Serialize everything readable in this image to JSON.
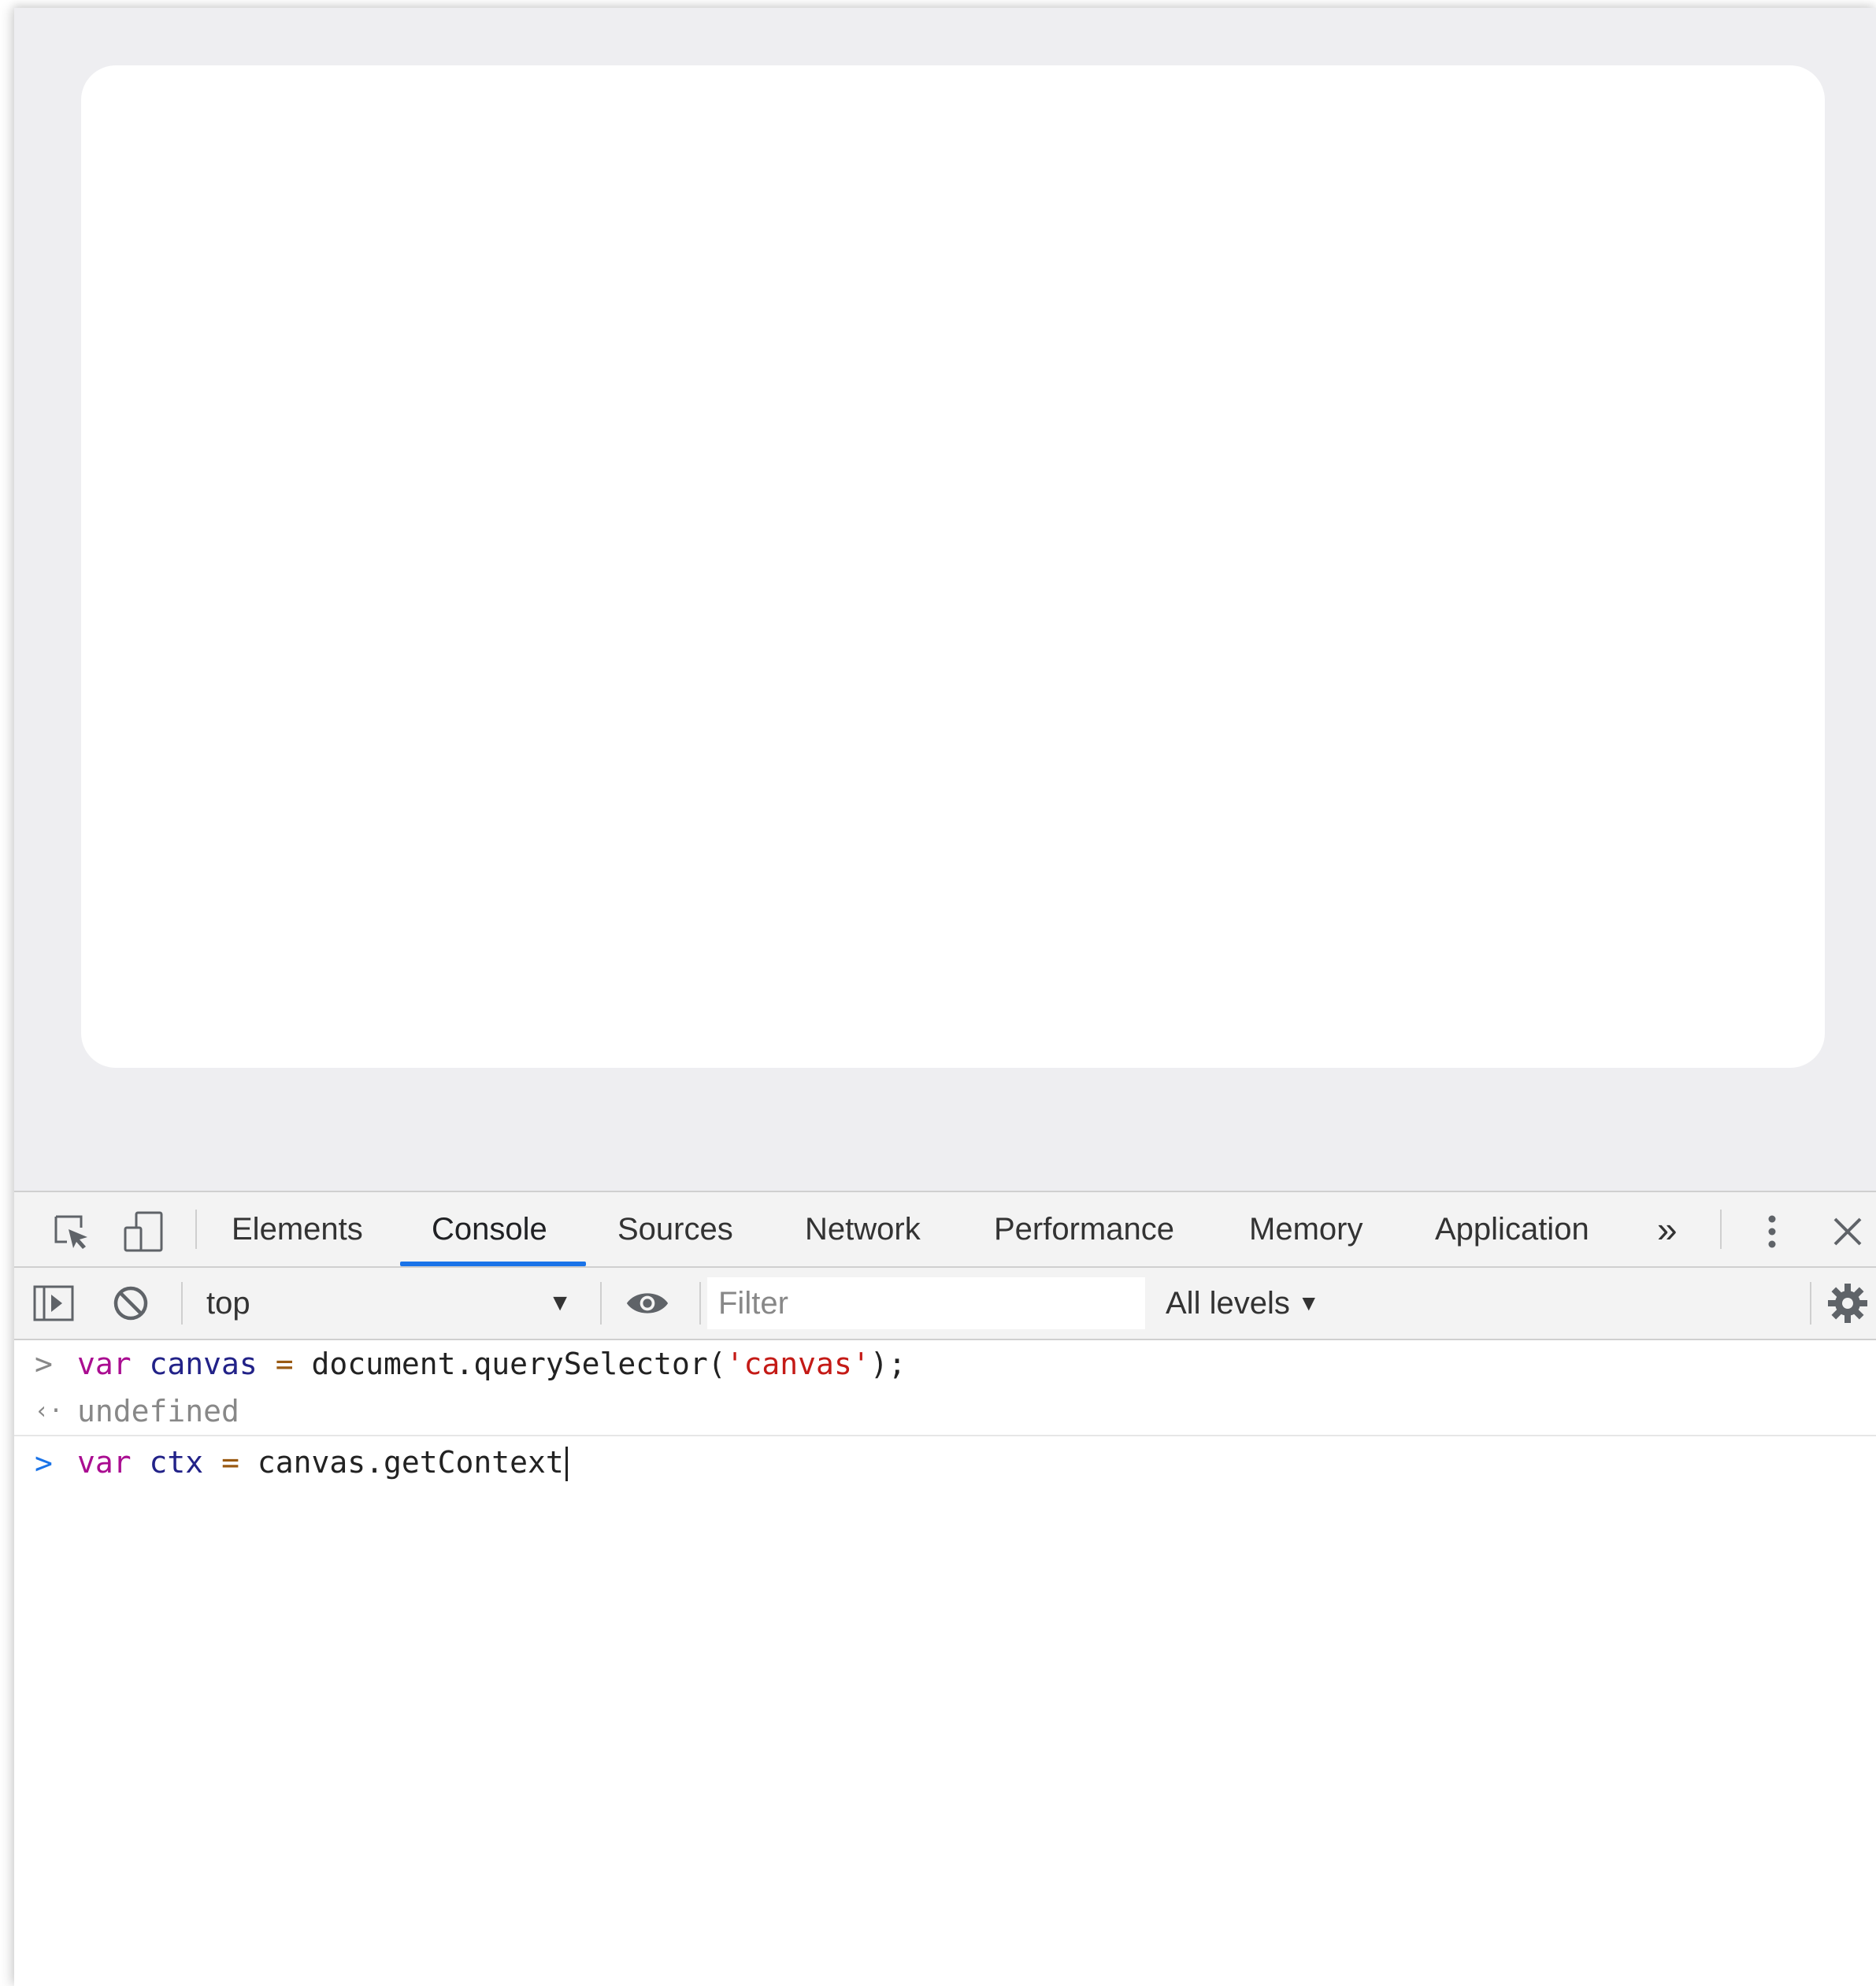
{
  "devtools": {
    "tabs": [
      {
        "label": "Elements"
      },
      {
        "label": "Console"
      },
      {
        "label": "Sources"
      },
      {
        "label": "Network"
      },
      {
        "label": "Performance"
      },
      {
        "label": "Memory"
      },
      {
        "label": "Application"
      }
    ],
    "active_tab": "Console",
    "more_tabs_glyph": "»",
    "close_glyph": "✕",
    "icons": {
      "inspect": "inspect-element-icon",
      "device": "device-toolbar-icon",
      "more": "more-tabs-icon",
      "menu": "kebab-menu-icon",
      "close": "close-icon"
    }
  },
  "console_toolbar": {
    "context": "top",
    "context_caret": "▼",
    "filter_placeholder": "Filter",
    "levels_label": "All levels",
    "levels_caret": "▼",
    "icons": {
      "sidebar": "show-console-sidebar-icon",
      "clear": "clear-console-icon",
      "live_expression": "eye-icon",
      "settings": "gear-icon"
    }
  },
  "console": {
    "lines": [
      {
        "type": "input",
        "prompt": ">",
        "tokens": [
          {
            "t": "var",
            "k": "kw"
          },
          {
            "t": " ",
            "k": "plain"
          },
          {
            "t": "canvas",
            "k": "var"
          },
          {
            "t": " ",
            "k": "plain"
          },
          {
            "t": "=",
            "k": "op"
          },
          {
            "t": " document.querySelector(",
            "k": "plain"
          },
          {
            "t": "'canvas'",
            "k": "str"
          },
          {
            "t": ");",
            "k": "plain"
          }
        ]
      },
      {
        "type": "output",
        "prompt": "‹·",
        "text": "undefined"
      },
      {
        "type": "active-input",
        "prompt": ">",
        "tokens": [
          {
            "t": "var",
            "k": "kw"
          },
          {
            "t": " ",
            "k": "plain"
          },
          {
            "t": "ctx",
            "k": "var"
          },
          {
            "t": " ",
            "k": "plain"
          },
          {
            "t": "=",
            "k": "op"
          },
          {
            "t": " canvas.getContext",
            "k": "plain"
          }
        ]
      }
    ]
  },
  "colors": {
    "accent": "#1a73e8",
    "keyword": "#aa0d91",
    "variable": "#222288",
    "operator": "#9a5a12",
    "string": "#c41a16",
    "muted": "#888888"
  }
}
